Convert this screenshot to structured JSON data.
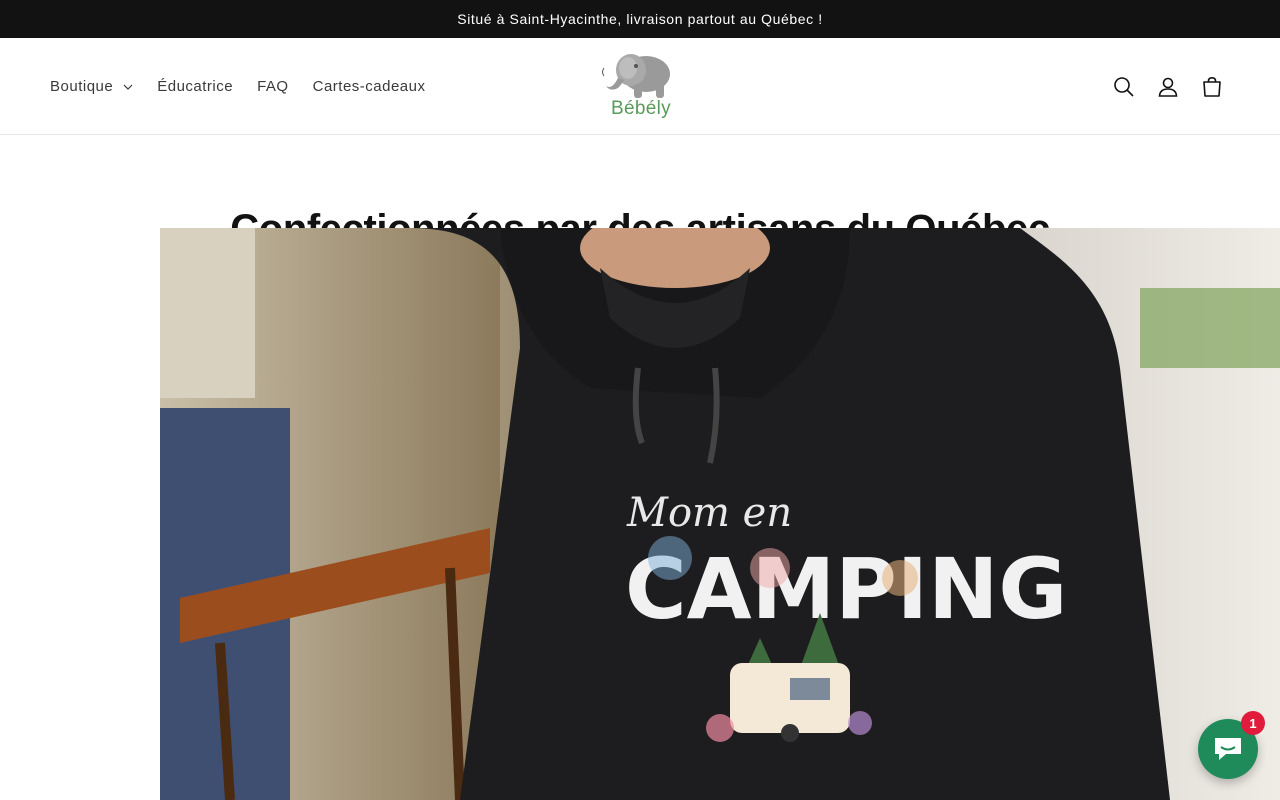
{
  "announcement": {
    "text": "Situé à Saint-Hyacinthe, livraison partout au Québec !"
  },
  "header": {
    "nav": [
      {
        "label": "Boutique",
        "has_dropdown": true
      },
      {
        "label": "Éducatrice"
      },
      {
        "label": "FAQ"
      },
      {
        "label": "Cartes-cadeaux"
      }
    ],
    "logo": {
      "text": "Bébély",
      "icon": "elephant-logo"
    },
    "icons": [
      "search-icon",
      "account-icon",
      "cart-icon"
    ]
  },
  "main": {
    "headline": "Confectionnées par des artisans du Québec",
    "hero": {
      "shirt_text_line1": "Mom en",
      "shirt_text_line2": "CAMPING"
    }
  },
  "chat": {
    "badge_count": "1",
    "icon": "chat-icon"
  },
  "colors": {
    "announcement_bg": "#121212",
    "chat_green": "#1f8a5a",
    "badge_red": "#e01b3c",
    "logo_green": "#5a9a5a"
  }
}
